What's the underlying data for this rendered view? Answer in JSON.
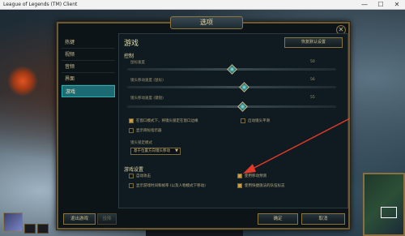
{
  "window": {
    "title": "League of Legends (TM) Client",
    "minimize": "—",
    "maximize": "☐",
    "close": "✕"
  },
  "dialog": {
    "header": "选项",
    "close": "✕",
    "sidebar": [
      "热键",
      "视频",
      "音频",
      "界面",
      "游戏"
    ],
    "active_tab": 4,
    "content_title": "游戏",
    "restore_button": "恢复默认设置",
    "control_section": "控制",
    "sliders": [
      {
        "label": "鼠标速度",
        "value": "50",
        "fraction": 0.5
      },
      {
        "label": "镜头移动速度 (鼠标)",
        "value": "56",
        "fraction": 0.56
      },
      {
        "label": "镜头移动速度 (键盘)",
        "value": "55",
        "fraction": 0.55
      }
    ],
    "control_checks": [
      {
        "label": "在窗口模式下，将镜头锁定在窗口边缘",
        "checked": true
      },
      {
        "label": "启动镜头平滑",
        "checked": false
      },
      {
        "label": "显示目标指示器",
        "checked": false
      }
    ],
    "lock_mode_label": "镜头锁定模式",
    "lock_mode_value": "基于位置方向镜头移动",
    "gameplay_section": "游戏设置",
    "gameplay_checks": [
      {
        "label": "自动攻击",
        "checked": false
      },
      {
        "label": "使用移动预测",
        "checked": true
      },
      {
        "label": "显示游戏时间和帧率 (以及人物模式下移动)",
        "checked": false
      },
      {
        "label": "使用快捷施法的队伍标志",
        "checked": true
      }
    ],
    "footer_left": "退出游戏",
    "footer_mid": "投降",
    "ok": "确定",
    "cancel": "取消"
  },
  "colors": {
    "accent": "#2fb0b0",
    "gold": "#8a7440",
    "arrow": "#e03a2a"
  }
}
